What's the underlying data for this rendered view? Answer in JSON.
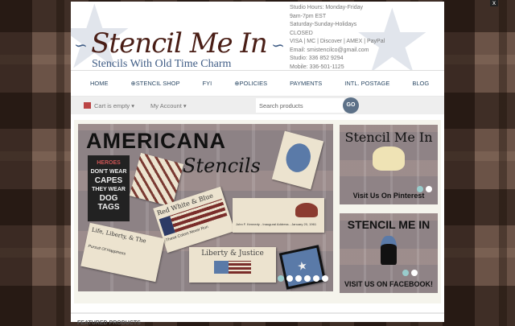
{
  "window": {
    "close_label": "x"
  },
  "header": {
    "logo_text": "Stencil Me In",
    "tagline": "Stencils With Old Time Charm",
    "info_lines": [
      "Studio Hours: Monday-Friday",
      "9am-7pm EST",
      "Saturday-Sunday-Holidays",
      "CLOSED",
      "VISA | MC | Discover | AMEX | PayPal",
      "Email: smistencilco@gmail.com",
      "Studio: 336 852 9294",
      "Mobile: 336-501-1125"
    ]
  },
  "nav": {
    "items": [
      "HOME",
      "⊕STENCIL SHOP",
      "FYI",
      "⊕POLICIES",
      "PAYMENTS",
      "INTL. POSTAGE",
      "BLOG"
    ]
  },
  "toolbar": {
    "cart": "Cart is empty ▾",
    "account": "My Account ▾",
    "search_placeholder": "Search products",
    "go": "GO"
  },
  "slider": {
    "title": "AMERICANA",
    "subtitle": "Stencils",
    "hero_lines": [
      "HEROES",
      "DON'T WEAR",
      "CAPES",
      "THEY WEAR",
      "DOG",
      "TAGS"
    ],
    "cards": [
      "Red White & Blue",
      "These Colors Never Run",
      "Life, Liberty, & The",
      "Pursuit Of Happiness",
      "Liberty & Justice",
      "John F. Kennedy - Inaugural Address - January 20, 1961"
    ],
    "slide_count": 6,
    "active_slide": 1
  },
  "ads": [
    {
      "title": "Stencil Me In",
      "caption": "Visit Us On Pinterest",
      "slide_count": 2,
      "active_slide": 1
    },
    {
      "title": "STENCIL ME IN",
      "caption": "VISIT US ON FACEBOOK!",
      "slide_count": 2,
      "active_slide": 1
    }
  ],
  "section": {
    "heading": "FEATURED PRODUCTS"
  }
}
